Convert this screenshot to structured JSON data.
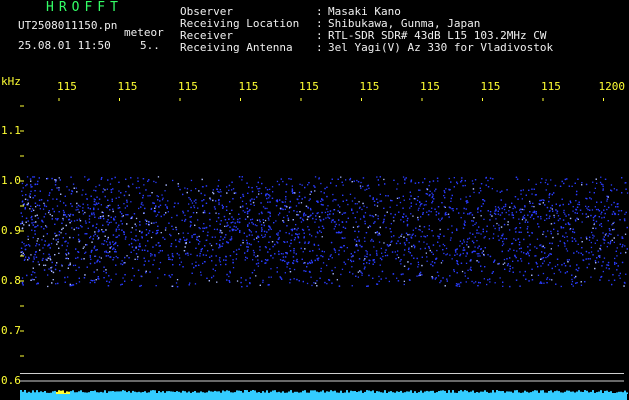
{
  "header": {
    "app_name": "HROFFT",
    "file_name": "UT2508011150.pn",
    "mode": "meteor",
    "date_time": "25.08.01 11:50",
    "count": "5..",
    "info": [
      {
        "key": "Observer",
        "value": "Masaki Kano"
      },
      {
        "key": "Receiving Location",
        "value": "Shibukawa, Gunma, Japan"
      },
      {
        "key": "Receiver",
        "value": "RTL-SDR SDR# 43dB L15 103.2MHz CW"
      },
      {
        "key": "Receiving Antenna",
        "value": "3el Yagi(V) Az 330 for Vladivostok"
      }
    ]
  },
  "chart_data": {
    "type": "heatmap",
    "time_axis_labels": [
      "115",
      "115",
      "115",
      "115",
      "115",
      "115",
      "115",
      "115",
      "115",
      "1200"
    ],
    "ylabel": "kHz",
    "y_tick_labels": [
      "1.1",
      "1.0",
      "0.9",
      "0.8",
      "0.7",
      "0.6"
    ],
    "y_ticks": [
      1.1,
      1.0,
      0.9,
      0.8,
      0.7,
      0.6
    ],
    "ylim": [
      0.58,
      1.2
    ],
    "noise_band": [
      0.79,
      1.01
    ],
    "reference_lines": [
      0.615,
      0.6
    ],
    "colors": {
      "noise": "#2a3cff",
      "bright": "#aab8ff",
      "line": "#cfcfcf",
      "bottom_strip": "#33ccff"
    }
  }
}
